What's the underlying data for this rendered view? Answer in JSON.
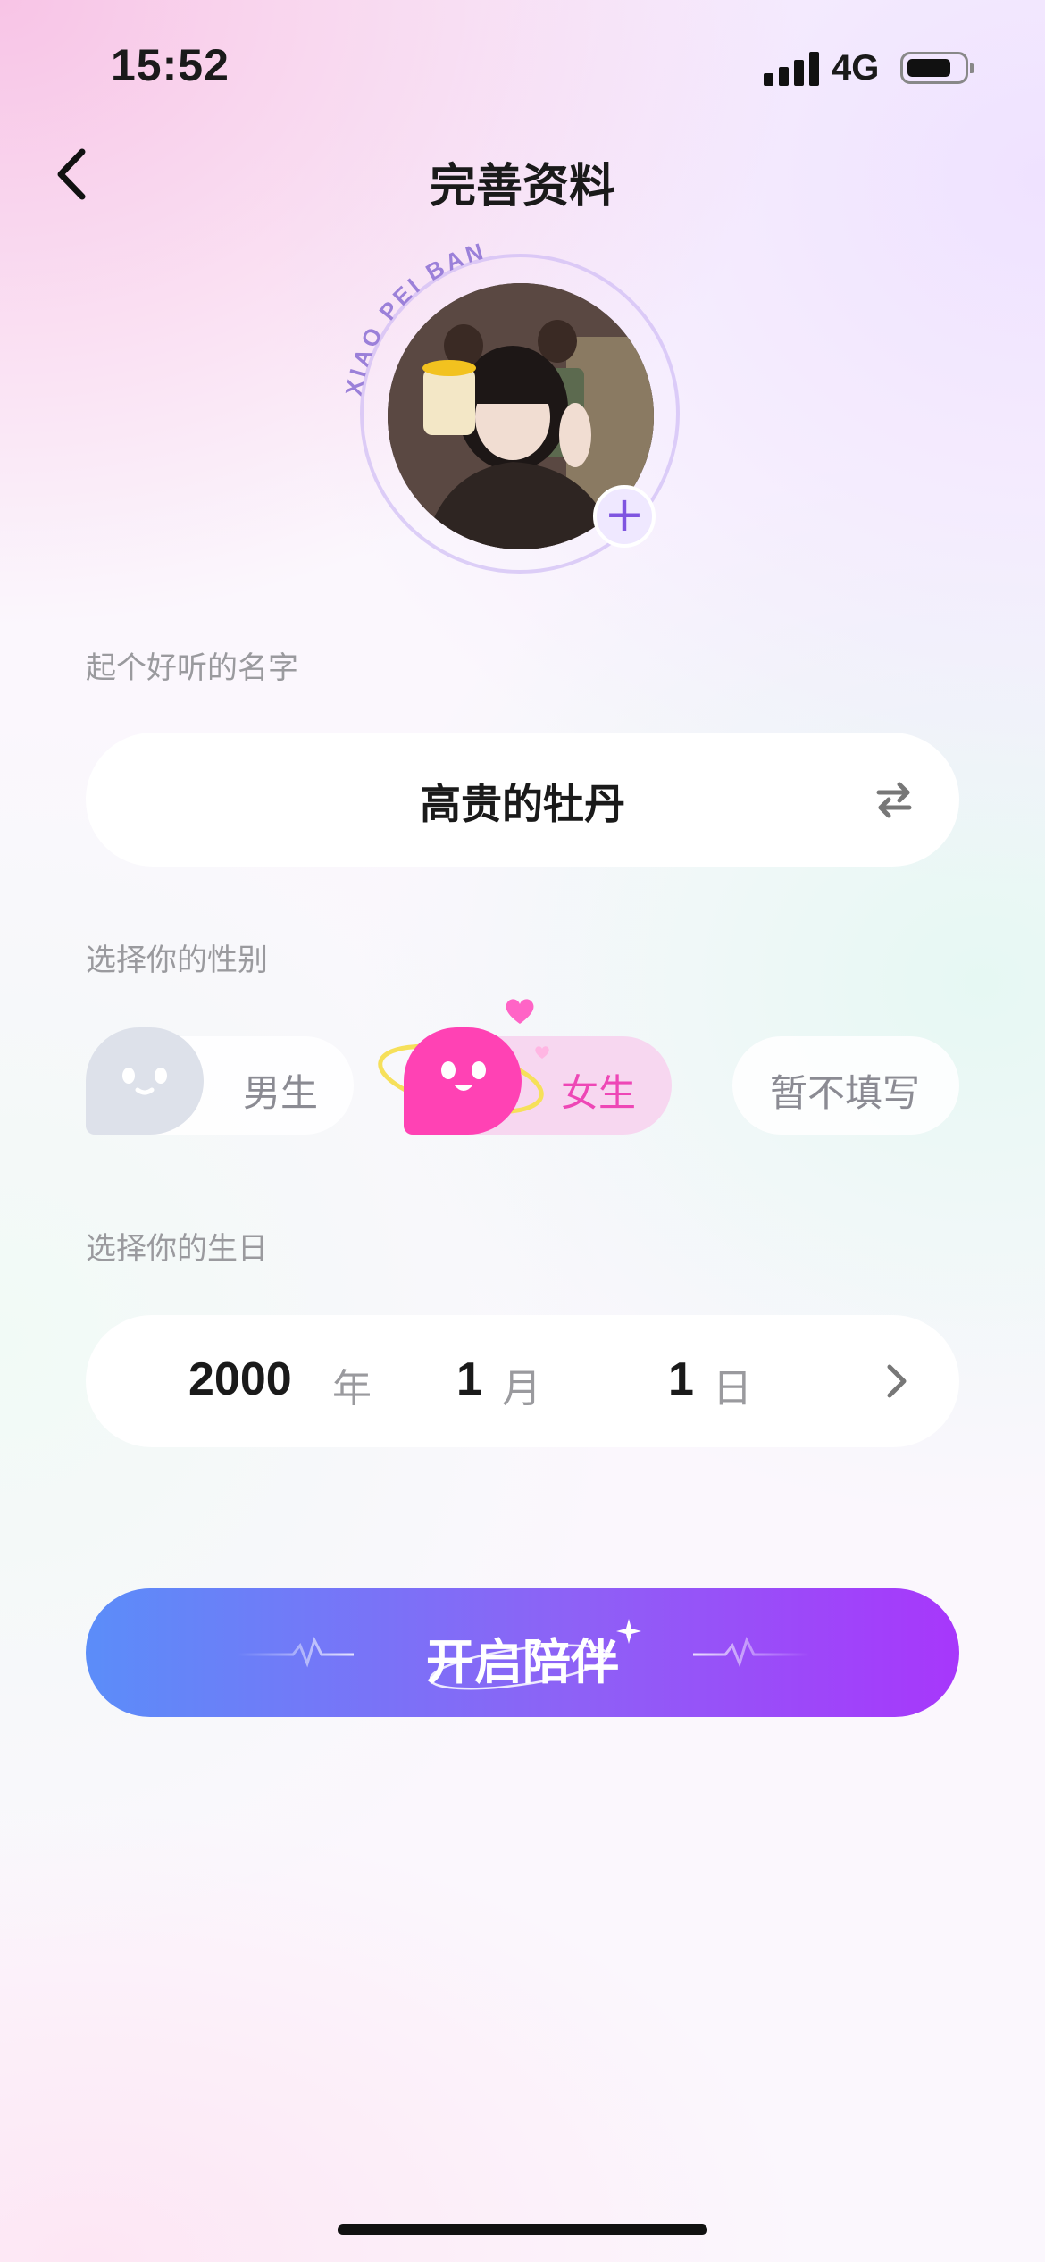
{
  "status_bar": {
    "time": "15:52",
    "network": "4G",
    "icons": [
      "signal-icon",
      "battery-icon"
    ]
  },
  "nav": {
    "back_icon": "chevron-left-icon",
    "title": "完善资料"
  },
  "avatar": {
    "brand_text": "XIAO PEI BAN",
    "add_icon": "plus-icon"
  },
  "name_section": {
    "label": "起个好听的名字",
    "value": "高贵的牡丹",
    "shuffle_icon": "swap-arrows-icon"
  },
  "gender_section": {
    "label": "选择你的性别",
    "options": [
      {
        "label": "男生",
        "selected": false
      },
      {
        "label": "女生",
        "selected": true
      },
      {
        "label": "暂不填写",
        "selected": false
      }
    ]
  },
  "birthday_section": {
    "label": "选择你的生日",
    "year": "2000",
    "year_unit": "年",
    "month": "1",
    "month_unit": "月",
    "day": "1",
    "day_unit": "日",
    "chevron_icon": "chevron-right-icon"
  },
  "start_button": {
    "label": "开启陪伴"
  },
  "colors": {
    "accent_pink": "#ff42b4",
    "button_gradient_start": "#5b8df9",
    "button_gradient_end": "#a737fb",
    "label_gray": "#9a9a9e"
  }
}
